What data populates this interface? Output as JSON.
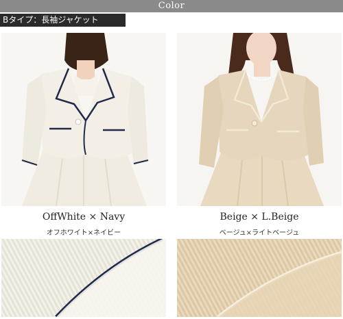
{
  "header": {
    "title": "Color"
  },
  "type_label": "Bタイプ：長袖ジャケット",
  "variants": [
    {
      "name_en": "OffWhite × Navy",
      "name_ja": "オフホワイト×ネイビー",
      "colors": {
        "body": "#f3efe6",
        "piping": "#1f2a4a"
      }
    },
    {
      "name_en": "Beige × L.Beige",
      "name_ja": "ベージュ×ライトベージュ",
      "colors": {
        "body": "#e6d6bd",
        "piping": "#f3ead6"
      }
    }
  ]
}
